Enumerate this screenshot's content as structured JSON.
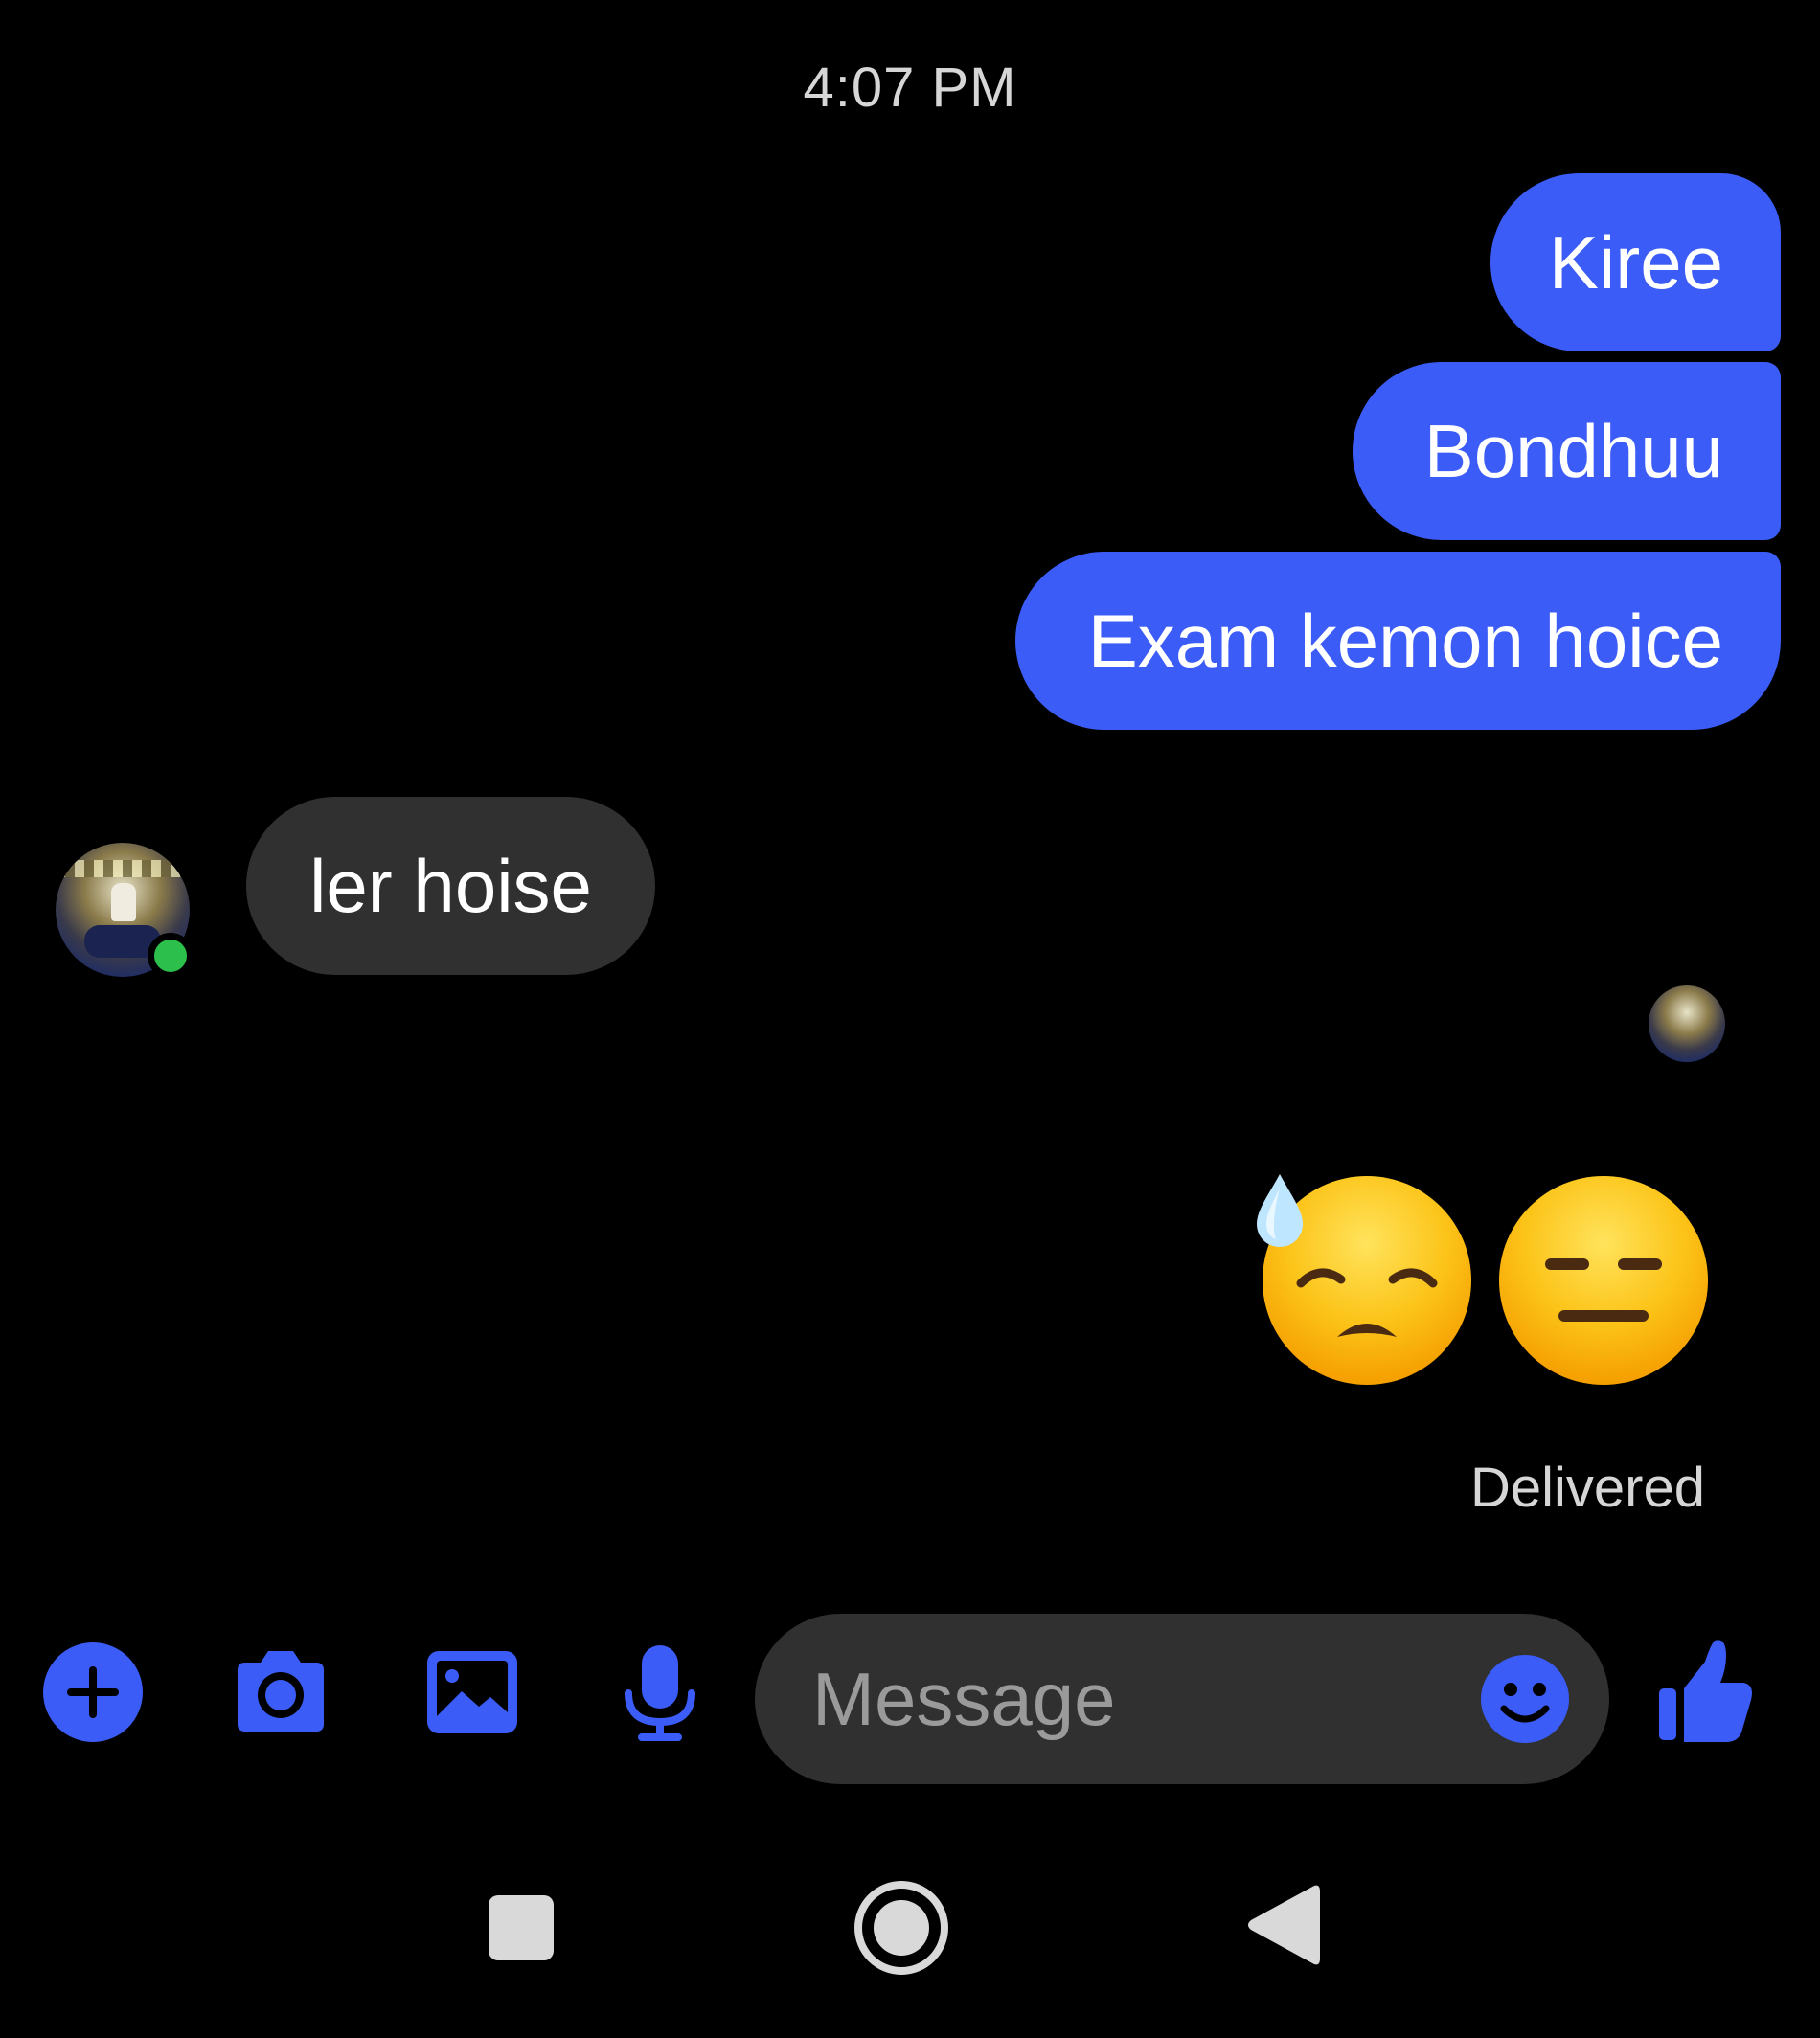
{
  "timestamp": "4:07 PM",
  "messages_out": [
    {
      "text": "Kiree"
    },
    {
      "text": "Bondhuu"
    },
    {
      "text": "Exam kemon hoice"
    }
  ],
  "message_in": {
    "text": "ler hoise"
  },
  "reactions": [
    "downcast-face-with-sweat-emoji",
    "expressionless-face-emoji"
  ],
  "status": "Delivered",
  "composer": {
    "placeholder": "Message",
    "value": ""
  },
  "icons": {
    "plus": "plus-icon",
    "camera": "camera-icon",
    "gallery": "image-icon",
    "mic": "microphone-icon",
    "emoji": "smiley-icon",
    "like": "thumbs-up-icon"
  },
  "colors": {
    "background": "#000000",
    "accent": "#3b5cf6",
    "incoming_bubble": "#303030",
    "composer": "#303030",
    "online": "#2dbf4b",
    "muted_text": "#d6d6d6",
    "nav": "#d9d9d9"
  }
}
